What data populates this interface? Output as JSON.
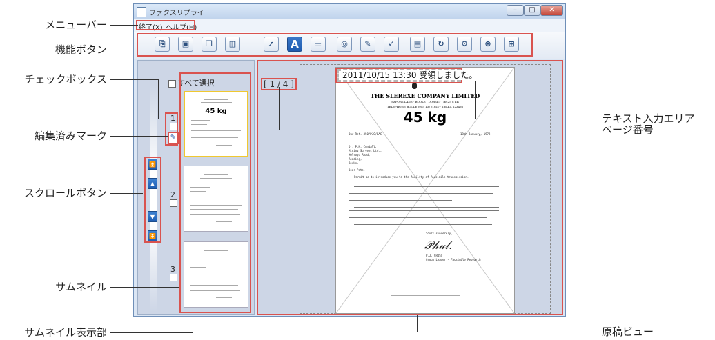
{
  "labels_left": {
    "menubar": "メニューバー",
    "function_buttons": "機能ボタン",
    "checkbox": "チェックボックス",
    "edited_mark": "編集済みマーク",
    "scroll_buttons": "スクロールボタン",
    "thumbnail": "サムネイル",
    "thumbnail_area": "サムネイル表示部"
  },
  "labels_right": {
    "text_input": "テキスト入力エリア",
    "page_number": "ページ番号",
    "original_view": "原稿ビュー"
  },
  "window": {
    "title": "ファクスリプライ",
    "minimize": "–",
    "maximize": "□",
    "close": "✕"
  },
  "menu": {
    "exit": "終了(X)",
    "help": "ヘルプ(H)"
  },
  "toolbar_icons": [
    "doc-arrow-icon",
    "save-icon",
    "copy-doc-icon",
    "trash-icon",
    "select-pointer-icon",
    "text-a-icon",
    "list-icon",
    "stamp-icon",
    "pen-icon",
    "sign-check-icon",
    "panel-icon",
    "rotate-page-icon",
    "settings-icon",
    "zoom-in-icon",
    "doc-add-icon"
  ],
  "thumbs": {
    "select_all": "すべて選択",
    "page1": "1",
    "page2": "2",
    "page3": "3",
    "weight": "45 kg"
  },
  "viewer": {
    "page_indicator": "[ 1  /  4 ]",
    "text_entry": "2011/10/15 13:30 受領しました。",
    "doc_company": "THE SLEREXE COMPANY LIMITED",
    "doc_address1": "SAPORS LANE · BOOLE · DORSET · BH25 8 ER",
    "doc_address2": "TELEPHONE BOOLE (945 13) 51617 · TELEX 123456",
    "doc_weight": "45 kg",
    "doc_ref": "Our Ref. 350/PJC/EAC",
    "doc_date": "18th January, 1972.",
    "doc_recipient": [
      "Dr. P.N. Cundall,",
      "Mining Surveys Ltd.,",
      "Holroyd Road,",
      "Reading,",
      "Berks."
    ],
    "doc_salutation": "Dear Pete,",
    "doc_para1": "Permit me to introduce you to the facility of facsimile transmission.",
    "doc_closing": "Yours sincerely,",
    "doc_signer": "P.J. CROSS",
    "doc_signer_title": "Group Leader - Facsimile Research"
  }
}
